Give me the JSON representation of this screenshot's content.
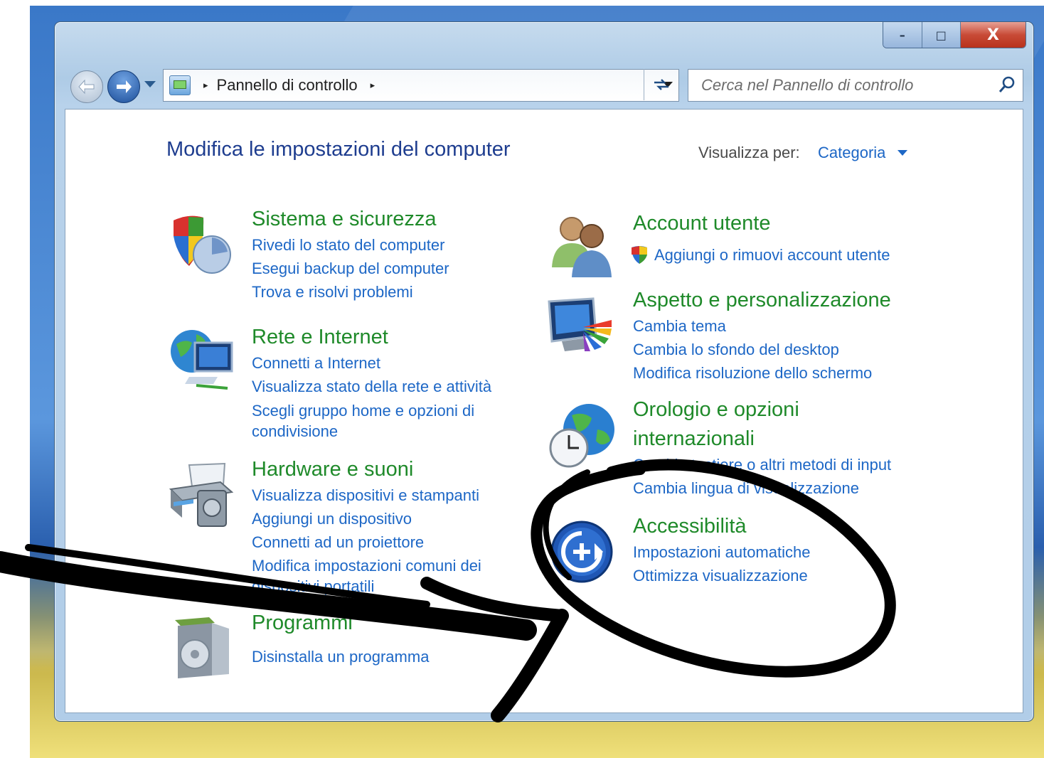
{
  "window": {
    "caption": {
      "minimize": "–",
      "maximize": "□",
      "close": "X"
    }
  },
  "navigation": {
    "address_crumb": "Pannello di controllo",
    "crumb_separator": "▸",
    "search_placeholder": "Cerca nel Pannello di controllo"
  },
  "main": {
    "title": "Modifica le impostazioni del computer",
    "view_by_label": "Visualizza per:",
    "view_by_value": "Categoria"
  },
  "categories": {
    "system": {
      "title": "Sistema e sicurezza",
      "links": [
        "Rivedi lo stato del computer",
        "Esegui backup del computer",
        "Trova e risolvi problemi"
      ]
    },
    "network": {
      "title": "Rete e Internet",
      "links": [
        "Connetti a Internet",
        "Visualizza stato della rete e attività",
        "Scegli gruppo home e opzioni di",
        "condivisione"
      ]
    },
    "hardware": {
      "title": "Hardware e suoni",
      "links": [
        "Visualizza dispositivi e stampanti",
        "Aggiungi un dispositivo",
        "Connetti ad un proiettore",
        "Modifica impostazioni comuni dei",
        "dispositivi portatili"
      ]
    },
    "programs": {
      "title": "Programmi",
      "links": [
        "Disinstalla un programma"
      ]
    },
    "accounts": {
      "title": "Account utente",
      "links": [
        "Aggiungi o rimuovi account utente"
      ]
    },
    "appearance": {
      "title": "Aspetto e personalizzazione",
      "links": [
        "Cambia tema",
        "Cambia lo sfondo del desktop",
        "Modifica risoluzione dello schermo"
      ]
    },
    "clock": {
      "title_lines": [
        "Orologio e opzioni",
        "internazionali"
      ],
      "links": [
        "Cambia tastiere o altri metodi di input",
        "Cambia lingua di visualizzazione"
      ]
    },
    "accessibility": {
      "title": "Accessibilità",
      "links": [
        "Impostazioni automatiche",
        "Ottimizza visualizzazione"
      ]
    }
  },
  "colors": {
    "category_title": "#1f8a2a",
    "link": "#1d67c6",
    "page_title": "#1e3d8f",
    "annotation_ink": "#000000"
  },
  "icons": {
    "system": "shield-icon",
    "network": "network-globe-icon",
    "hardware": "printer-icon",
    "programs": "software-box-icon",
    "accounts": "users-icon",
    "appearance": "monitor-palette-icon",
    "clock": "globe-clock-icon",
    "accessibility": "ease-of-access-icon",
    "uac": "uac-shield-icon"
  }
}
